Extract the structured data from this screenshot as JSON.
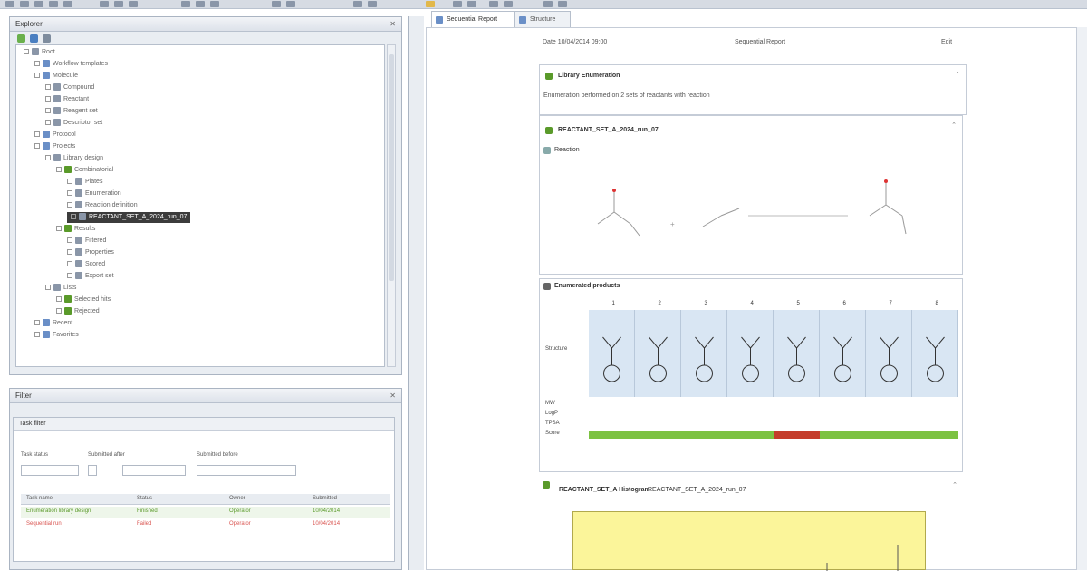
{
  "window": {
    "explorer_title": "Explorer",
    "filter_title": "Filter",
    "doc_tabs": [
      "Sequential Report",
      "Structure"
    ]
  },
  "tree": {
    "rows": [
      {
        "label": "Root",
        "depth": 0
      },
      {
        "label": "Workflow templates",
        "depth": 1
      },
      {
        "label": "Molecule",
        "depth": 1
      },
      {
        "label": "Compound",
        "depth": 2
      },
      {
        "label": "Reactant",
        "depth": 2
      },
      {
        "label": "Reagent set",
        "depth": 2
      },
      {
        "label": "Descriptor set",
        "depth": 2
      },
      {
        "label": "Protocol",
        "depth": 1
      },
      {
        "label": "Projects",
        "depth": 1
      },
      {
        "label": "Library design",
        "depth": 2
      },
      {
        "label": "Combinatorial",
        "depth": 3
      },
      {
        "label": "Plates",
        "depth": 4
      },
      {
        "label": "Enumeration",
        "depth": 4
      },
      {
        "label": "Reaction definition",
        "depth": 4
      },
      {
        "label": "REACTANT_SET_A_2024_run_07",
        "depth": 4,
        "selected": true
      },
      {
        "label": "Results",
        "depth": 3
      },
      {
        "label": "Filtered",
        "depth": 4
      },
      {
        "label": "Properties",
        "depth": 4
      },
      {
        "label": "Scored",
        "depth": 4
      },
      {
        "label": "Export set",
        "depth": 4
      },
      {
        "label": "Lists",
        "depth": 2
      },
      {
        "label": "Selected hits",
        "depth": 3
      },
      {
        "label": "Rejected",
        "depth": 3
      },
      {
        "label": "Recent",
        "depth": 1
      },
      {
        "label": "Favorites",
        "depth": 1
      }
    ]
  },
  "filter": {
    "sub_title": "Task filter",
    "labels": [
      "Task status",
      "Submitted after",
      "Submitted before"
    ],
    "columns": [
      "Task name",
      "Status",
      "Owner",
      "Submitted"
    ],
    "rows": [
      {
        "name": "Enumeration library design",
        "status": "Finished",
        "owner": "Operator",
        "date": "10/04/2014",
        "color": "#5a9a2a"
      },
      {
        "name": "Sequential run",
        "status": "Failed",
        "owner": "Operator",
        "date": "10/04/2014",
        "color": "#d9534f"
      }
    ]
  },
  "doc": {
    "header_left": "Date 10/04/2014 09:00",
    "header_mid": "Sequential Report",
    "header_right": "Edit",
    "sec1_title": "Library Enumeration",
    "sec1_sub": "Enumeration performed on 2 sets of reactants with reaction",
    "sec2_title": "REACTANT_SET_A_2024_run_07",
    "reaction_label": "Reaction",
    "sec3_title": "Enumerated products",
    "row_labels": [
      "Structure",
      "MW",
      "LogP",
      "TPSA",
      "Score"
    ],
    "col_numbers": [
      "1",
      "2",
      "3",
      "4",
      "5",
      "6",
      "7",
      "8"
    ],
    "sec4_title": "REACTANT_SET_A Histogram",
    "sec4_sub": "REACTANT_SET_A_2024_run_07"
  },
  "colors": {
    "accent": "#6a8fc7",
    "bar_green": "#7cc242",
    "bar_red": "#c43d2b",
    "highlight": "#d9e6f3",
    "yellow": "#fbf59a"
  }
}
